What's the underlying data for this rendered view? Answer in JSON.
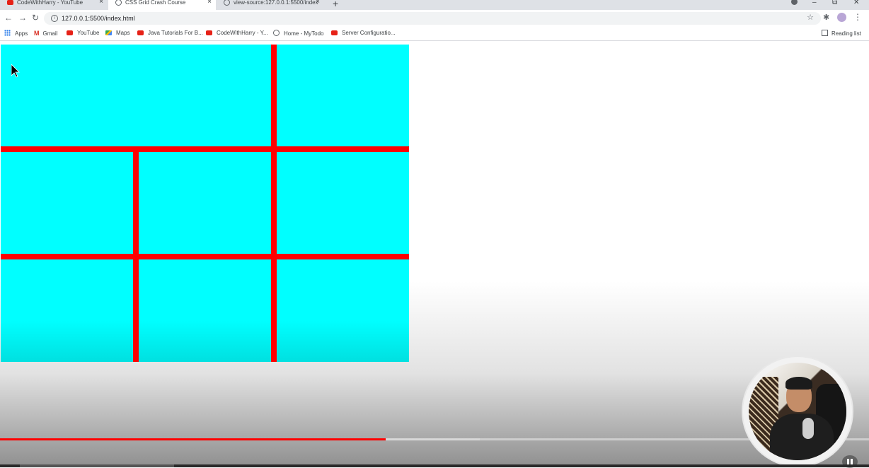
{
  "browser": {
    "tabs": [
      {
        "title": "CodeWithHarry - YouTube",
        "favicon": "youtube-icon",
        "active": false
      },
      {
        "title": "CSS Grid Crash Course",
        "favicon": "globe-icon",
        "active": true
      },
      {
        "title": "view-source:127.0.0.1:5500/index",
        "favicon": "globe-icon",
        "active": false
      }
    ],
    "new_tab_symbol": "+",
    "close_symbol": "×",
    "address": {
      "url": "127.0.0.1:5500/index.html"
    },
    "bookmarks": [
      {
        "label": "Apps",
        "icon": "apps-grid-icon"
      },
      {
        "label": "Gmail",
        "icon": "gmail-icon"
      },
      {
        "label": "YouTube",
        "icon": "youtube-icon"
      },
      {
        "label": "Maps",
        "icon": "maps-icon"
      },
      {
        "label": "Java Tutorials For B...",
        "icon": "youtube-icon"
      },
      {
        "label": "CodeWithHarry - Y...",
        "icon": "youtube-icon"
      },
      {
        "label": "Home - MyTodo",
        "icon": "globe-icon"
      },
      {
        "label": "Server Configuratio...",
        "icon": "youtube-icon"
      }
    ],
    "reading_list": "Reading list"
  },
  "page": {
    "grid_colors": {
      "cell": "#00ffff",
      "gap": "#ff0000"
    },
    "grid_cells": 8
  },
  "video": {
    "progress_played_fraction": 0.444,
    "progress_buffered_fraction": 0.552,
    "accent_color": "#ff0000"
  }
}
